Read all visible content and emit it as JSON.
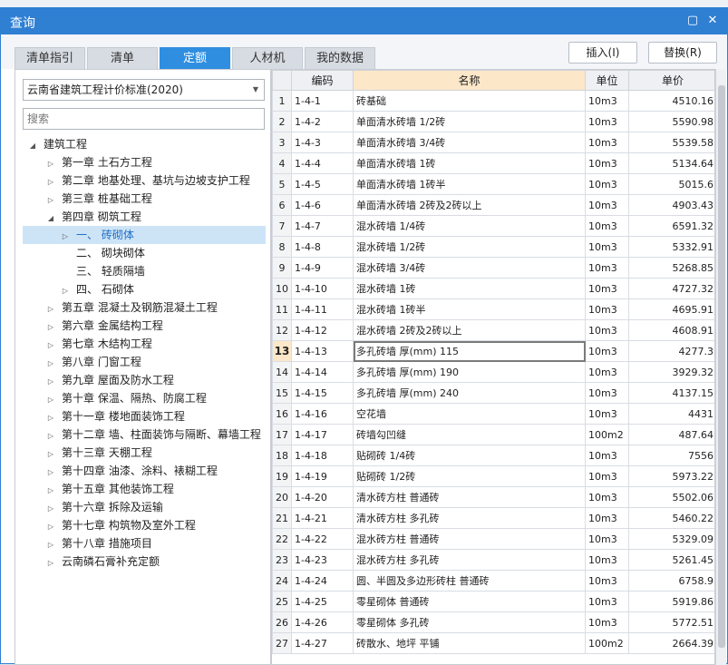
{
  "window": {
    "title": "查询"
  },
  "tabs": [
    {
      "label": "清单指引"
    },
    {
      "label": "清单"
    },
    {
      "label": "定额"
    },
    {
      "label": "人材机"
    },
    {
      "label": "我的数据"
    }
  ],
  "buttons": {
    "insert": "插入(I)",
    "replace": "替换(R)"
  },
  "left_panel": {
    "select_value": "云南省建筑工程计价标准(2020)",
    "search_placeholder": "搜索"
  },
  "tree": [
    {
      "label": "建筑工程",
      "level": 0,
      "toggle": "◢"
    },
    {
      "label": "第一章 土石方工程",
      "level": 1,
      "toggle": "▷"
    },
    {
      "label": "第二章 地基处理、基坑与边坡支护工程",
      "level": 1,
      "toggle": "▷"
    },
    {
      "label": "第三章 桩基础工程",
      "level": 1,
      "toggle": "▷"
    },
    {
      "label": "第四章 砌筑工程",
      "level": 1,
      "toggle": "◢"
    },
    {
      "label": "一、 砖砌体",
      "level": 2,
      "toggle": "▷",
      "selected": true
    },
    {
      "label": "二、 砌块砌体",
      "level": 2,
      "toggle": ""
    },
    {
      "label": "三、 轻质隔墙",
      "level": 2,
      "toggle": ""
    },
    {
      "label": "四、 石砌体",
      "level": 2,
      "toggle": "▷"
    },
    {
      "label": "第五章 混凝土及钢筋混凝土工程",
      "level": 1,
      "toggle": "▷"
    },
    {
      "label": "第六章 金属结构工程",
      "level": 1,
      "toggle": "▷"
    },
    {
      "label": "第七章 木结构工程",
      "level": 1,
      "toggle": "▷"
    },
    {
      "label": "第八章 门窗工程",
      "level": 1,
      "toggle": "▷"
    },
    {
      "label": "第九章 屋面及防水工程",
      "level": 1,
      "toggle": "▷"
    },
    {
      "label": "第十章 保温、隔热、防腐工程",
      "level": 1,
      "toggle": "▷"
    },
    {
      "label": "第十一章 楼地面装饰工程",
      "level": 1,
      "toggle": "▷"
    },
    {
      "label": "第十二章 墙、柱面装饰与隔断、幕墙工程",
      "level": 1,
      "toggle": "▷"
    },
    {
      "label": "第十三章 天棚工程",
      "level": 1,
      "toggle": "▷"
    },
    {
      "label": "第十四章 油漆、涂料、裱糊工程",
      "level": 1,
      "toggle": "▷"
    },
    {
      "label": "第十五章 其他装饰工程",
      "level": 1,
      "toggle": "▷"
    },
    {
      "label": "第十六章 拆除及运输",
      "level": 1,
      "toggle": "▷"
    },
    {
      "label": "第十七章 构筑物及室外工程",
      "level": 1,
      "toggle": "▷"
    },
    {
      "label": "第十八章 措施项目",
      "level": 1,
      "toggle": "▷"
    },
    {
      "label": "云南磷石膏补充定额",
      "level": 1,
      "toggle": "▷"
    }
  ],
  "table": {
    "headers": {
      "code": "编码",
      "name": "名称",
      "unit": "单位",
      "price": "单价"
    },
    "current_row": 13,
    "rows": [
      {
        "idx": "1",
        "code": "1-4-1",
        "name": "砖基础",
        "unit": "10m3",
        "price": "4510.16"
      },
      {
        "idx": "2",
        "code": "1-4-2",
        "name": "单面清水砖墙 1/2砖",
        "unit": "10m3",
        "price": "5590.98"
      },
      {
        "idx": "3",
        "code": "1-4-3",
        "name": "单面清水砖墙 3/4砖",
        "unit": "10m3",
        "price": "5539.58"
      },
      {
        "idx": "4",
        "code": "1-4-4",
        "name": "单面清水砖墙 1砖",
        "unit": "10m3",
        "price": "5134.64"
      },
      {
        "idx": "5",
        "code": "1-4-5",
        "name": "单面清水砖墙 1砖半",
        "unit": "10m3",
        "price": "5015.6"
      },
      {
        "idx": "6",
        "code": "1-4-6",
        "name": "单面清水砖墙 2砖及2砖以上",
        "unit": "10m3",
        "price": "4903.43"
      },
      {
        "idx": "7",
        "code": "1-4-7",
        "name": "混水砖墙 1/4砖",
        "unit": "10m3",
        "price": "6591.32"
      },
      {
        "idx": "8",
        "code": "1-4-8",
        "name": "混水砖墙 1/2砖",
        "unit": "10m3",
        "price": "5332.91"
      },
      {
        "idx": "9",
        "code": "1-4-9",
        "name": "混水砖墙 3/4砖",
        "unit": "10m3",
        "price": "5268.85"
      },
      {
        "idx": "10",
        "code": "1-4-10",
        "name": "混水砖墙 1砖",
        "unit": "10m3",
        "price": "4727.32"
      },
      {
        "idx": "11",
        "code": "1-4-11",
        "name": "混水砖墙 1砖半",
        "unit": "10m3",
        "price": "4695.91"
      },
      {
        "idx": "12",
        "code": "1-4-12",
        "name": "混水砖墙 2砖及2砖以上",
        "unit": "10m3",
        "price": "4608.91"
      },
      {
        "idx": "13",
        "code": "1-4-13",
        "name": "多孔砖墙 厚(mm) 115",
        "unit": "10m3",
        "price": "4277.3"
      },
      {
        "idx": "14",
        "code": "1-4-14",
        "name": "多孔砖墙 厚(mm) 190",
        "unit": "10m3",
        "price": "3929.32"
      },
      {
        "idx": "15",
        "code": "1-4-15",
        "name": "多孔砖墙 厚(mm) 240",
        "unit": "10m3",
        "price": "4137.15"
      },
      {
        "idx": "16",
        "code": "1-4-16",
        "name": "空花墙",
        "unit": "10m3",
        "price": "4431"
      },
      {
        "idx": "17",
        "code": "1-4-17",
        "name": "砖墙勾凹缝",
        "unit": "100m2",
        "price": "487.64"
      },
      {
        "idx": "18",
        "code": "1-4-18",
        "name": "贴砌砖 1/4砖",
        "unit": "10m3",
        "price": "7556"
      },
      {
        "idx": "19",
        "code": "1-4-19",
        "name": "贴砌砖 1/2砖",
        "unit": "10m3",
        "price": "5973.22"
      },
      {
        "idx": "20",
        "code": "1-4-20",
        "name": "清水砖方柱 普通砖",
        "unit": "10m3",
        "price": "5502.06"
      },
      {
        "idx": "21",
        "code": "1-4-21",
        "name": "清水砖方柱 多孔砖",
        "unit": "10m3",
        "price": "5460.22"
      },
      {
        "idx": "22",
        "code": "1-4-22",
        "name": "混水砖方柱 普通砖",
        "unit": "10m3",
        "price": "5329.09"
      },
      {
        "idx": "23",
        "code": "1-4-23",
        "name": "混水砖方柱 多孔砖",
        "unit": "10m3",
        "price": "5261.45"
      },
      {
        "idx": "24",
        "code": "1-4-24",
        "name": "圆、半圆及多边形砖柱 普通砖",
        "unit": "10m3",
        "price": "6758.9"
      },
      {
        "idx": "25",
        "code": "1-4-25",
        "name": "零星砌体 普通砖",
        "unit": "10m3",
        "price": "5919.86"
      },
      {
        "idx": "26",
        "code": "1-4-26",
        "name": "零星砌体 多孔砖",
        "unit": "10m3",
        "price": "5772.51"
      },
      {
        "idx": "27",
        "code": "1-4-27",
        "name": "砖散水、地坪 平铺",
        "unit": "100m2",
        "price": "2664.39"
      }
    ]
  }
}
